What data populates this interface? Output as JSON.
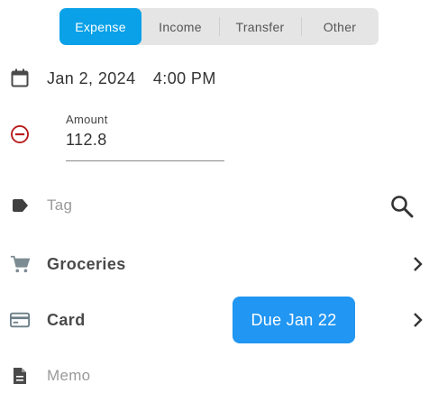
{
  "type_tabs": [
    {
      "label": "Expense",
      "selected": true
    },
    {
      "label": "Income",
      "selected": false
    },
    {
      "label": "Transfer",
      "selected": false
    },
    {
      "label": "Other",
      "selected": false
    }
  ],
  "datetime": {
    "date": "Jan 2, 2024",
    "time": "4:00 PM",
    "icon": "calendar-icon"
  },
  "amount": {
    "label": "Amount",
    "value": "112.8",
    "sign_icon": "minus-circle-icon"
  },
  "tag": {
    "placeholder": "Tag",
    "icon": "tag-icon",
    "search_icon": "search-icon"
  },
  "category": {
    "label": "Groceries",
    "icon": "shopping-cart-icon",
    "chevron_icon": "chevron-right-icon"
  },
  "account": {
    "label": "Card",
    "icon": "credit-card-icon",
    "due_badge": "Due Jan 22",
    "chevron_icon": "chevron-right-icon"
  },
  "memo": {
    "placeholder": "Memo",
    "icon": "document-icon"
  },
  "colors": {
    "accent": "#0aa1e8",
    "badge": "#2196f3",
    "expense_sign": "#b71c1c",
    "icon_gray": "#7d8b92"
  }
}
